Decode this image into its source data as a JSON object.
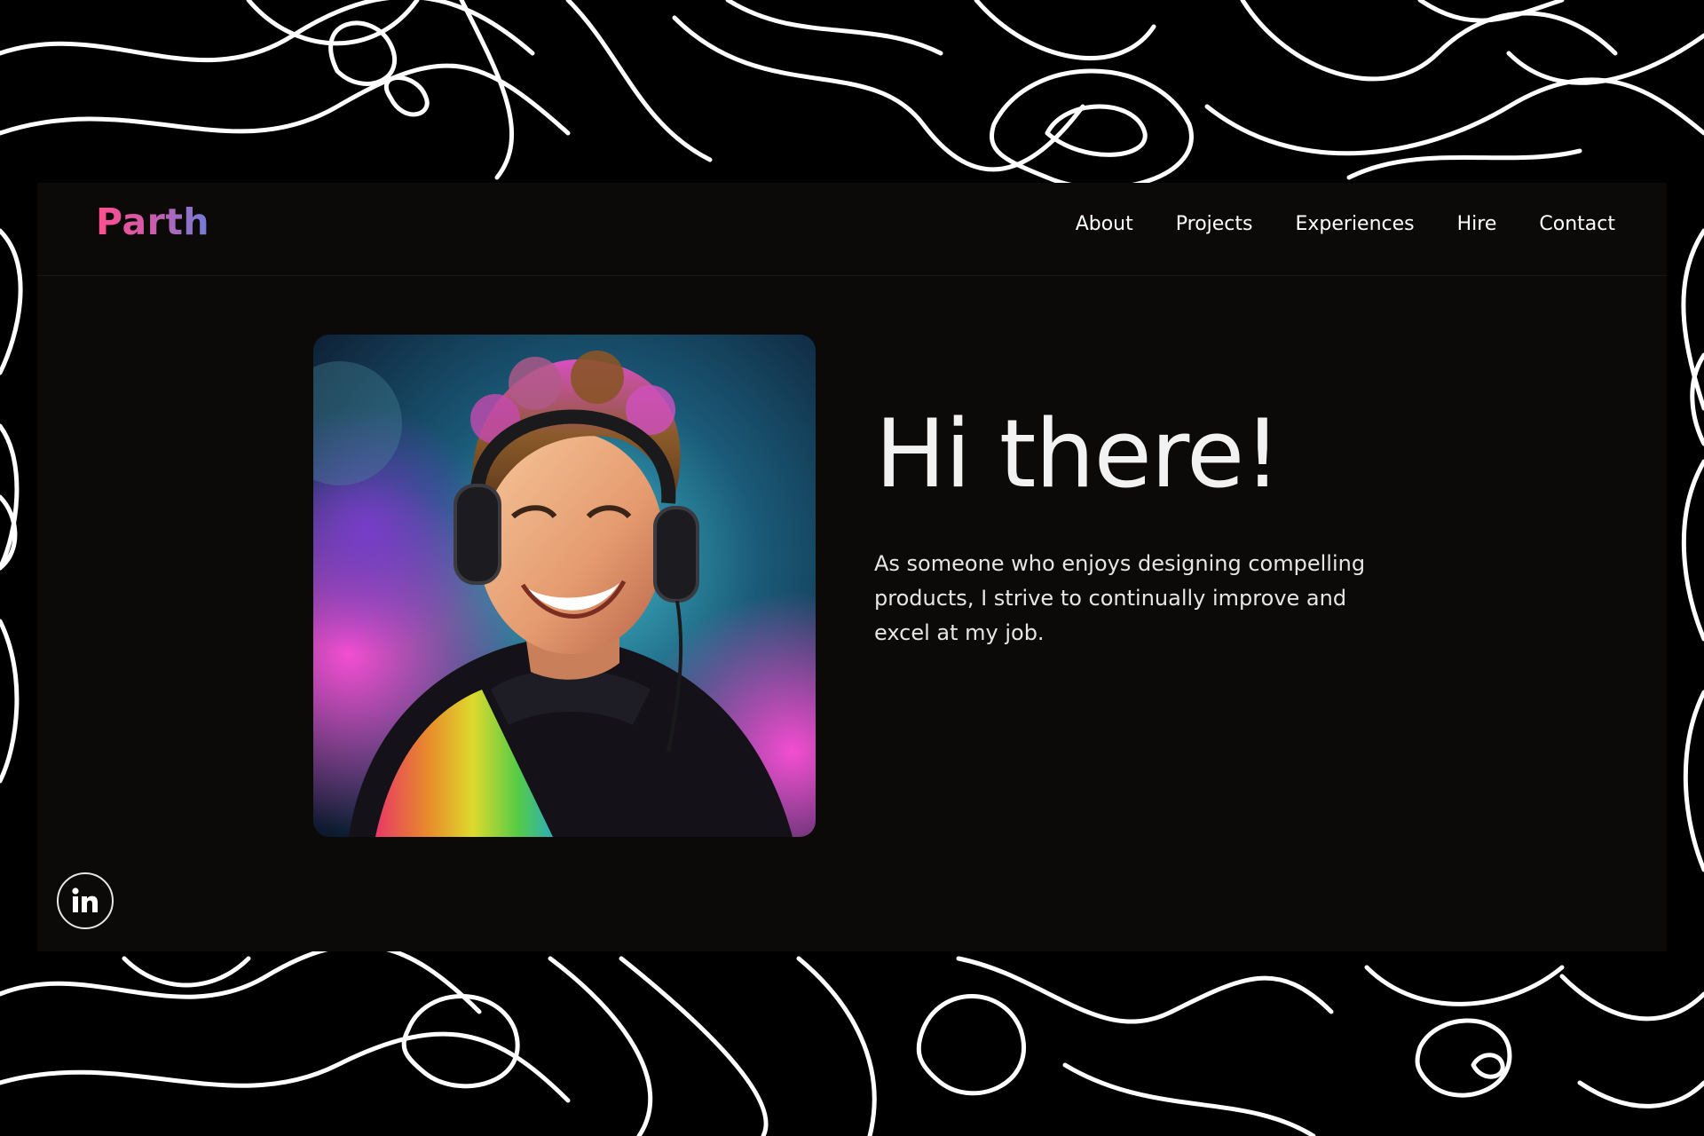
{
  "brand": {
    "logo_text": "Parth",
    "gradient_start": "#ff4f8f",
    "gradient_end": "#6f7dd8"
  },
  "nav": {
    "items": [
      {
        "label": "About"
      },
      {
        "label": "Projects"
      },
      {
        "label": "Experiences"
      },
      {
        "label": "Hire"
      },
      {
        "label": "Contact"
      }
    ]
  },
  "hero": {
    "heading": "Hi there!",
    "intro": "As someone who enjoys designing compelling products, I strive to continually improve and excel at my job.",
    "image_icon": "avatar-illustration"
  },
  "social": {
    "linkedin_icon": "linkedin-icon"
  },
  "colors": {
    "page_background": "#000000",
    "site_background": "#0b0a09",
    "text": "#ffffff",
    "pattern_lines": "#ffffff"
  }
}
